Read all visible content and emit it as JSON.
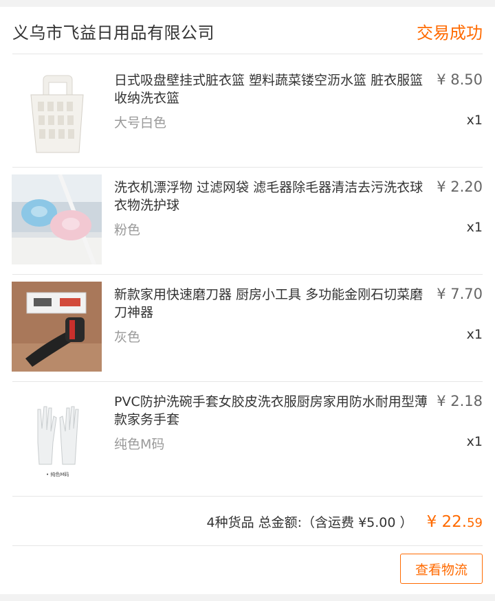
{
  "order": {
    "shop_name": "义乌市飞益日用品有限公司",
    "status": "交易成功"
  },
  "items": [
    {
      "title": "日式吸盘壁挂式脏衣篮 塑料蔬菜镂空沥水篮 脏衣服篮收纳洗衣篮",
      "sku": "大号白色",
      "price": "¥ 8.50",
      "qty": "x1"
    },
    {
      "title": "洗衣机漂浮物 过滤网袋 滤毛器除毛器清洁去污洗衣球衣物洗护球",
      "sku": "粉色",
      "price": "¥ 2.20",
      "qty": "x1"
    },
    {
      "title": "新款家用快速磨刀器 厨房小工具 多功能金刚石切菜磨刀神器",
      "sku": "灰色",
      "price": "¥ 7.70",
      "qty": "x1"
    },
    {
      "title": "PVC防护洗碗手套女胶皮洗衣服厨房家用防水耐用型薄款家务手套",
      "sku": "纯色M码",
      "price": "¥ 2.18",
      "qty": "x1",
      "image_caption": "• 纯色M码"
    }
  ],
  "summary": {
    "label": "4种货品 总金额:（含运费 ¥5.00 ）",
    "total_main": "¥ 22.",
    "total_cents": "59"
  },
  "actions": {
    "logistics_label": "查看物流"
  },
  "colors": {
    "accent": "#ff6a00"
  }
}
